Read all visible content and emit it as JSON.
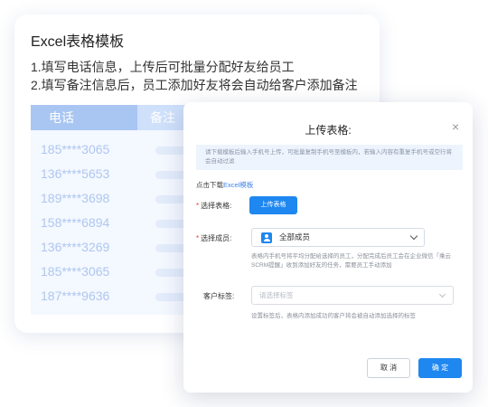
{
  "bg": {
    "title": "Excel表格模板",
    "line1": "1.填写电话信息，上传后可批量分配好友给员工",
    "line2": "2.填写备注信息后，员工添加好友将会自动给客户添加备注",
    "table": {
      "col_phone": "电话",
      "col_note": "备注",
      "phones": [
        "185****3065",
        "136****5653",
        "189****3698",
        "158****6894",
        "136****3269",
        "185****3065",
        "187****9636"
      ]
    }
  },
  "modal": {
    "title": "上传表格:",
    "close_icon": "close-icon",
    "info": "请下载模板后输入手机号上传，可批量复制手机号至模板内，若输入内容有重复手机号或空行将会自动过滤",
    "download_prefix": "点击下载",
    "download_link": "Excel模板",
    "upload_label": "选择表格:",
    "upload_button": "上传表格",
    "member_label": "选择成员:",
    "member_value": "全部成员",
    "member_help": "表格内手机号将平均分配给选择的员工，分配完成后员工会在企业微信「乘云SCRM提醒」收到添加好友的任务，需要员工手动添加",
    "tag_label": "客户标签:",
    "tag_placeholder": "请选择标签",
    "tag_help": "设置标签后，表格内添加成功的客户将会被自动添加选择的标签",
    "cancel": "取 消",
    "confirm": "确 定"
  },
  "colors": {
    "accent": "#1e87f0",
    "required": "#e34040",
    "table_head": "#a9c6f3"
  }
}
